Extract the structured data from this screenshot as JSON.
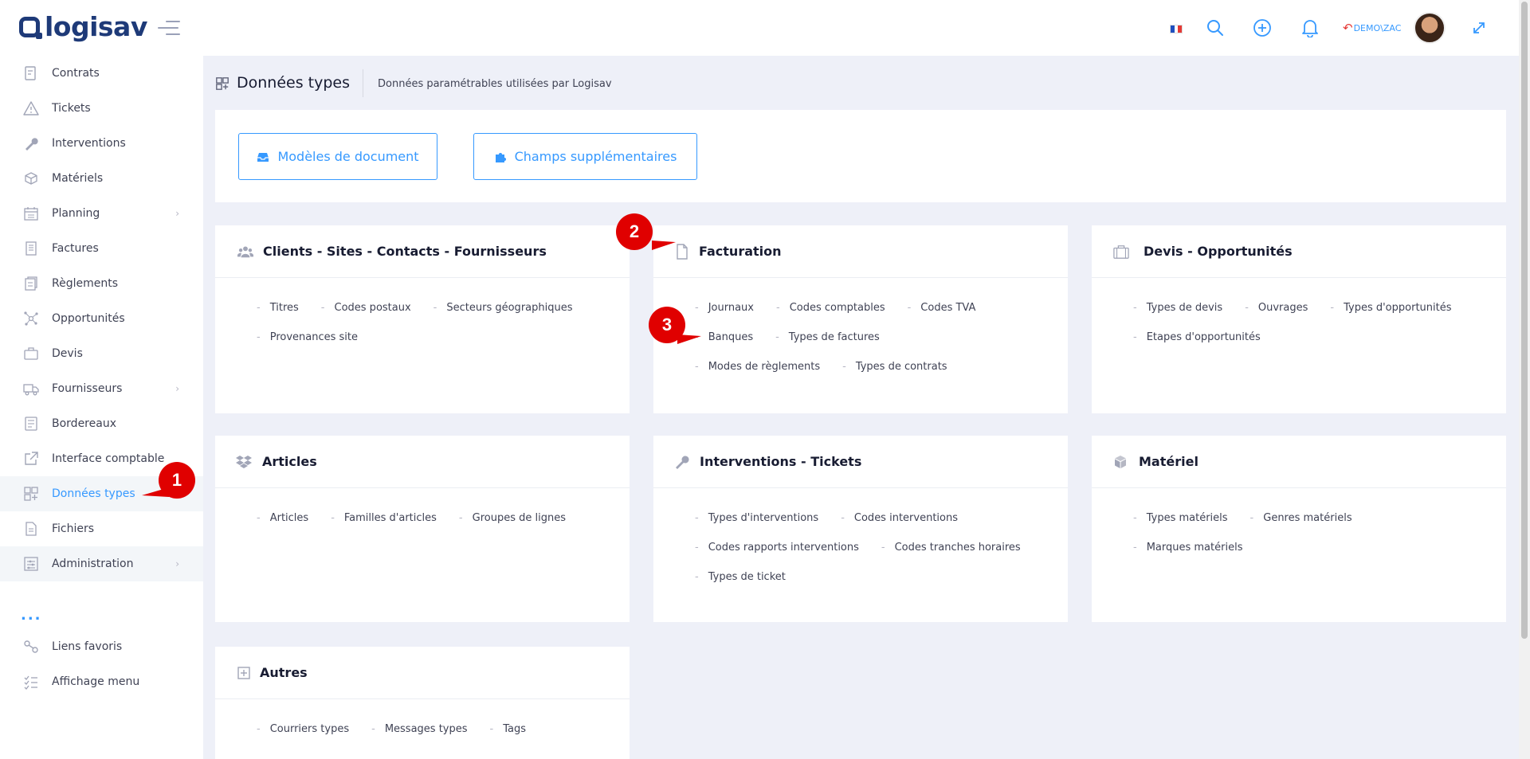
{
  "app": {
    "logo_text": "logisav",
    "brand_color": "#1e3a78",
    "accent_color": "#3699ff"
  },
  "header": {
    "user": "DEMO\\ZAC",
    "icons": [
      "flag-fr-icon",
      "search-icon",
      "add-circle-icon",
      "bell-icon",
      "return-arrow-icon",
      "avatar",
      "expand-icon"
    ]
  },
  "sidebar": {
    "items": [
      {
        "label": "Contrats",
        "icon": "contract-icon"
      },
      {
        "label": "Tickets",
        "icon": "warning-triangle-icon"
      },
      {
        "label": "Interventions",
        "icon": "wrench-icon"
      },
      {
        "label": "Matériels",
        "icon": "box-icon"
      },
      {
        "label": "Planning",
        "icon": "calendar-icon",
        "chevron": "›"
      },
      {
        "label": "Factures",
        "icon": "invoice-icon"
      },
      {
        "label": "Règlements",
        "icon": "payments-icon"
      },
      {
        "label": "Opportunités",
        "icon": "network-icon"
      },
      {
        "label": "Devis",
        "icon": "briefcase-icon"
      },
      {
        "label": "Fournisseurs",
        "icon": "truck-icon",
        "chevron": "›"
      },
      {
        "label": "Bordereaux",
        "icon": "list-doc-icon"
      },
      {
        "label": "Interface comptable",
        "icon": "external-link-icon"
      },
      {
        "label": "Données types",
        "icon": "grid-plus-icon"
      },
      {
        "label": "Fichiers",
        "icon": "file-icon"
      },
      {
        "label": "Administration",
        "icon": "settings-list-icon",
        "chevron": "›"
      }
    ],
    "more": "...",
    "extras": [
      {
        "label": "Liens favoris",
        "icon": "link-icon"
      },
      {
        "label": "Affichage menu",
        "icon": "checklist-icon"
      }
    ]
  },
  "subheader": {
    "title": "Données types",
    "subtitle": "Données paramétrables utilisées par Logisav"
  },
  "top_buttons": [
    {
      "label": "Modèles de document",
      "icon": "inbox-icon"
    },
    {
      "label": "Champs supplémentaires",
      "icon": "puzzle-icon"
    }
  ],
  "cards": [
    {
      "title": "Clients - Sites - Contacts - Fournisseurs",
      "icon": "users-icon",
      "links": [
        "Titres",
        "Codes postaux",
        "Secteurs géographiques",
        "Provenances site"
      ]
    },
    {
      "title": "Facturation",
      "icon": "file-icon",
      "links": [
        "Journaux",
        "Codes comptables",
        "Codes TVA",
        "Banques",
        "Types de factures",
        "Modes de règlements",
        "Types de contrats"
      ]
    },
    {
      "title": "Devis - Opportunités",
      "icon": "briefcase-icon",
      "links": [
        "Types de devis",
        "Ouvrages",
        "Types d'opportunités",
        "Etapes d'opportunités"
      ]
    },
    {
      "title": "Articles",
      "icon": "dropbox-icon",
      "links": [
        "Articles",
        "Familles d'articles",
        "Groupes de lignes"
      ]
    },
    {
      "title": "Interventions - Tickets",
      "icon": "wrench-icon",
      "links": [
        "Types d'interventions",
        "Codes interventions",
        "Codes rapports interventions",
        "Codes tranches horaires",
        "Types de ticket"
      ]
    },
    {
      "title": "Matériel",
      "icon": "cube-icon",
      "links": [
        "Types matériels",
        "Genres matériels",
        "Marques matériels"
      ]
    },
    {
      "title": "Autres",
      "icon": "plus-square-icon",
      "links": [
        "Courriers types",
        "Messages types",
        "Tags"
      ]
    }
  ],
  "markers": [
    "1",
    "2",
    "3"
  ]
}
